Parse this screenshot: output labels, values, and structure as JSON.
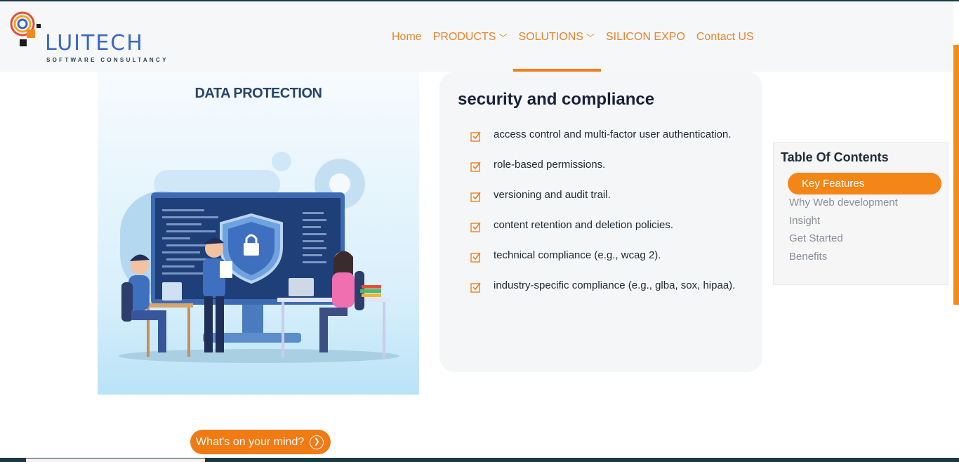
{
  "header": {
    "logo_text": "LUITECH",
    "logo_subtitle": "SOFTWARE CONSULTANCY",
    "nav": [
      {
        "label": "Home"
      },
      {
        "label": "PRODUCTS",
        "chevron": "chevron-down-icon"
      },
      {
        "label": "SOLUTIONS",
        "chevron": "chevron-down-icon"
      },
      {
        "label": "SILICON EXPO"
      },
      {
        "label": "Contact US"
      }
    ]
  },
  "illustration": {
    "title": "DATA PROTECTION"
  },
  "security": {
    "title": "security and compliance",
    "items": [
      "access control and multi-factor user authentication.",
      "role-based permissions.",
      "versioning and audit trail.",
      "content retention and deletion policies.",
      "technical compliance (e.g., wcag 2).",
      "industry-specific compliance (e.g., glba, sox, hipaa)."
    ]
  },
  "toc": {
    "title": "Table Of Contents",
    "active": "Key Features",
    "items": [
      "Why Web development",
      "Insight",
      "Get Started",
      "Benefits"
    ]
  },
  "chat": {
    "label": "What's on your mind?",
    "icon": "chevron-right-icon"
  },
  "colors": {
    "accent": "#f07f1a",
    "title_dark": "#17223b",
    "logo_blue": "#3a67c4"
  }
}
